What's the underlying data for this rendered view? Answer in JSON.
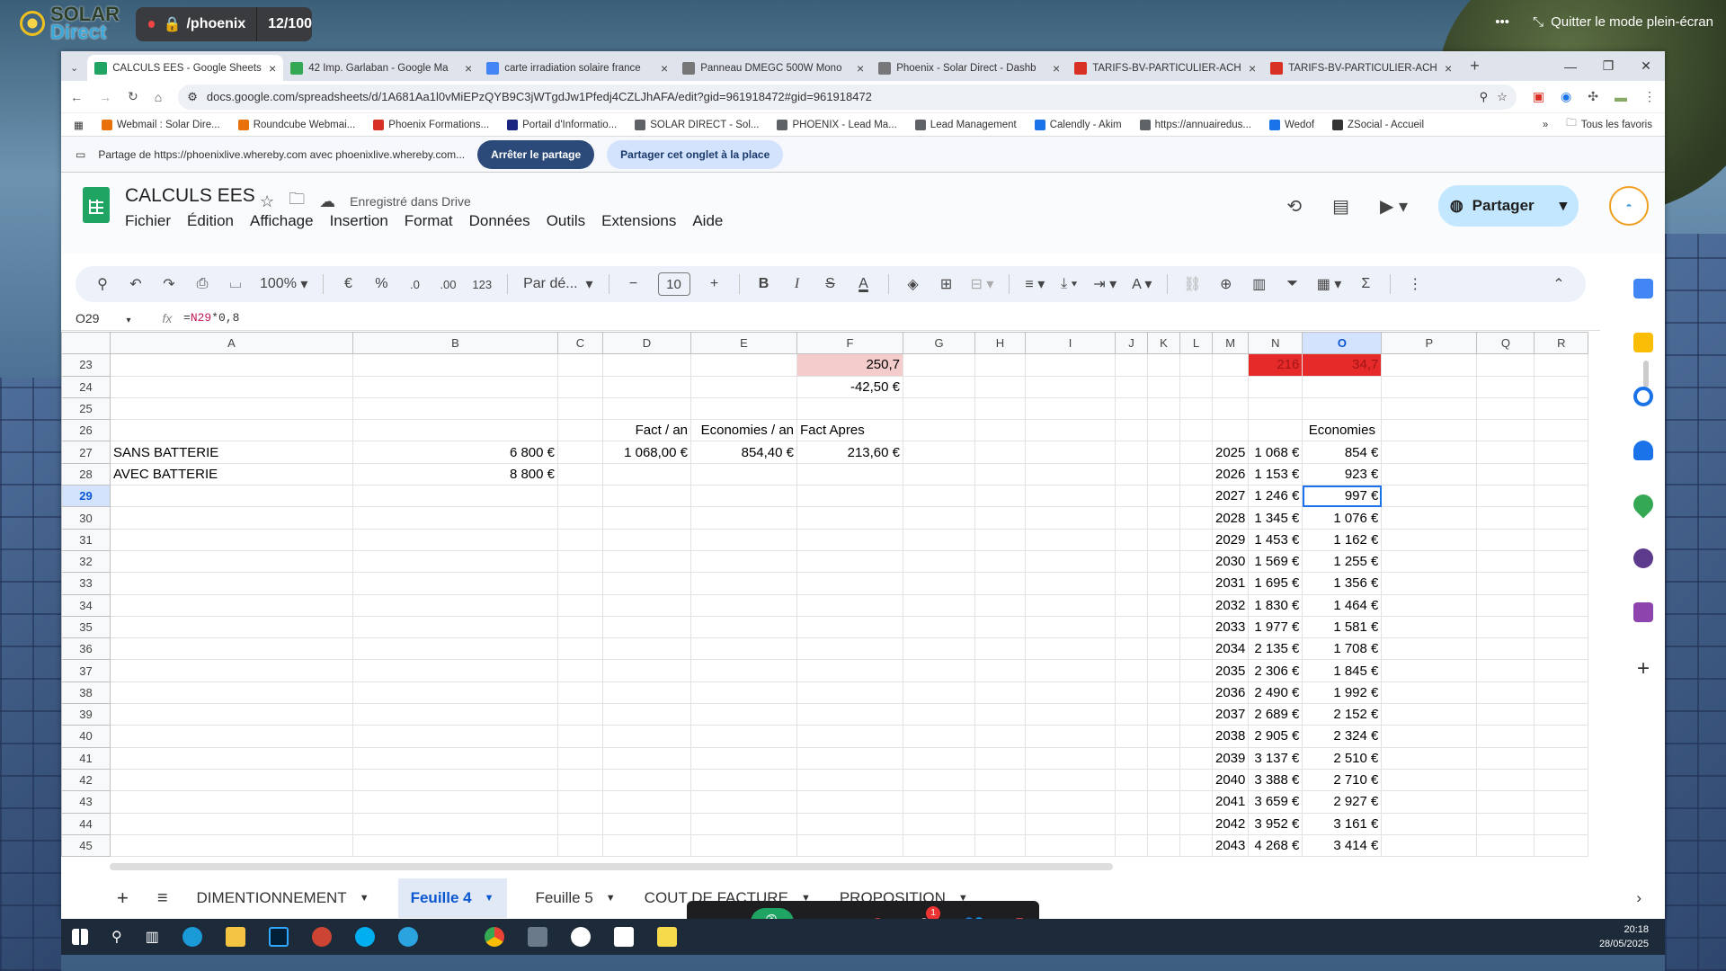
{
  "brand": {
    "line1": "SOLAR",
    "line2": "Direct"
  },
  "meet": {
    "room": "/phoenix",
    "count": "12/100",
    "exit_fullscreen": "Quitter le mode plein-écran",
    "more": "•••",
    "reactions_badge": "1"
  },
  "browser": {
    "tabs": [
      {
        "label": "CALCULS EES - Google Sheets",
        "color": "#1fa463"
      },
      {
        "label": "42 Imp. Garlaban - Google Ma",
        "color": "#34a853"
      },
      {
        "label": "carte irradiation solaire france",
        "color": "#4285f4"
      },
      {
        "label": "Panneau DMEGC 500W Mono",
        "color": "#777777"
      },
      {
        "label": "Phoenix - Solar Direct - Dashb",
        "color": "#777777"
      },
      {
        "label": "TARIFS-BV-PARTICULIER-ACH",
        "color": "#d93025"
      },
      {
        "label": "TARIFS-BV-PARTICULIER-ACH",
        "color": "#d93025"
      }
    ],
    "new_tab": "+",
    "url": "docs.google.com/spreadsheets/d/1A681Aa1l0vMiEPzQYB9C3jWTgdJw1Pfedj4CZLJhAFA/edit?gid=961918472#gid=961918472",
    "bookmarks": [
      {
        "label": "Webmail : Solar Dire...",
        "color": "#e8710a"
      },
      {
        "label": "Roundcube Webmai...",
        "color": "#e8710a"
      },
      {
        "label": "Phoenix Formations...",
        "color": "#d93025"
      },
      {
        "label": "Portail d'Informatio...",
        "color": "#1a237e"
      },
      {
        "label": "SOLAR DIRECT - Sol...",
        "color": "#5f6368"
      },
      {
        "label": "PHOENIX - Lead Ma...",
        "color": "#5f6368"
      },
      {
        "label": "Lead Management",
        "color": "#5f6368"
      },
      {
        "label": "Calendly - Akim",
        "color": "#1a73e8"
      },
      {
        "label": "https://annuairedus...",
        "color": "#5f6368"
      },
      {
        "label": "Wedof",
        "color": "#1a73e8"
      },
      {
        "label": "ZSocial - Accueil",
        "color": "#333333"
      }
    ],
    "bookmarks_more": "»",
    "all_favorites": "Tous les favoris"
  },
  "sharebar": {
    "text": "Partage de https://phoenixlive.whereby.com avec phoenixlive.whereby.com...",
    "stop": "Arrêter le partage",
    "share_tab": "Partager cet onglet à la place"
  },
  "sheets": {
    "title": "CALCULS EES",
    "saved": "Enregistré dans Drive",
    "menus": [
      "Fichier",
      "Édition",
      "Affichage",
      "Insertion",
      "Format",
      "Données",
      "Outils",
      "Extensions",
      "Aide"
    ],
    "share": "Partager",
    "toolbar": {
      "zoom": "100%",
      "currency": "€",
      "percent": "%",
      "dec_minus": ".0",
      "dec_plus": ".00",
      "num_format": "123",
      "font": "Par dé...",
      "font_size": "10",
      "bold": "B",
      "italic": "I"
    },
    "name_box": "O29",
    "formula": {
      "prefix": "=",
      "ref": "N29",
      "suffix": "*0,8"
    },
    "columns": [
      "A",
      "B",
      "C",
      "D",
      "E",
      "F",
      "G",
      "H",
      "I",
      "J",
      "K",
      "L",
      "M",
      "N",
      "O",
      "P",
      "Q",
      "R"
    ],
    "selected_column": "O",
    "rows": [
      {
        "n": "23",
        "F": "250,7",
        "N": "216",
        "O": "34,7"
      },
      {
        "n": "24",
        "F": "-42,50 €"
      },
      {
        "n": "25"
      },
      {
        "n": "26",
        "D": "Fact / an",
        "E": "Economies / an",
        "F": "Fact Apres",
        "O": "Economies"
      },
      {
        "n": "27",
        "A": "SANS BATTERIE",
        "B": "6 800 €",
        "D": "1 068,00 €",
        "E": "854,40 €",
        "F": "213,60 €",
        "M": "2025",
        "N": "1 068 €",
        "O": "854 €"
      },
      {
        "n": "28",
        "A": "AVEC BATTERIE",
        "B": "8 800 €",
        "M": "2026",
        "N": "1 153 €",
        "O": "923 €"
      },
      {
        "n": "29",
        "M": "2027",
        "N": "1 246 €",
        "O": "997 €"
      },
      {
        "n": "30",
        "M": "2028",
        "N": "1 345 €",
        "O": "1 076 €"
      },
      {
        "n": "31",
        "M": "2029",
        "N": "1 453 €",
        "O": "1 162 €"
      },
      {
        "n": "32",
        "M": "2030",
        "N": "1 569 €",
        "O": "1 255 €"
      },
      {
        "n": "33",
        "M": "2031",
        "N": "1 695 €",
        "O": "1 356 €"
      },
      {
        "n": "34",
        "M": "2032",
        "N": "1 830 €",
        "O": "1 464 €"
      },
      {
        "n": "35",
        "M": "2033",
        "N": "1 977 €",
        "O": "1 581 €"
      },
      {
        "n": "36",
        "M": "2034",
        "N": "2 135 €",
        "O": "1 708 €"
      },
      {
        "n": "37",
        "M": "2035",
        "N": "2 306 €",
        "O": "1 845 €"
      },
      {
        "n": "38",
        "M": "2036",
        "N": "2 490 €",
        "O": "1 992 €"
      },
      {
        "n": "39",
        "M": "2037",
        "N": "2 689 €",
        "O": "2 152 €"
      },
      {
        "n": "40",
        "M": "2038",
        "N": "2 905 €",
        "O": "2 324 €"
      },
      {
        "n": "41",
        "M": "2039",
        "N": "3 137 €",
        "O": "2 510 €"
      },
      {
        "n": "42",
        "M": "2040",
        "N": "3 388 €",
        "O": "2 710 €"
      },
      {
        "n": "43",
        "M": "2041",
        "N": "3 659 €",
        "O": "2 927 €"
      },
      {
        "n": "44",
        "M": "2042",
        "N": "3 952 €",
        "O": "3 161 €"
      },
      {
        "n": "45",
        "M": "2043",
        "N": "4 268 €",
        "O": "3 414 €"
      }
    ],
    "sheet_tabs": [
      "DIMENTIONNEMENT",
      "Feuille 4",
      "Feuille 5",
      "COUT DE FACTURE",
      "PROPOSITION"
    ],
    "active_sheet": "Feuille 4"
  },
  "clock": {
    "time": "20:18",
    "date": "28/05/2025"
  }
}
